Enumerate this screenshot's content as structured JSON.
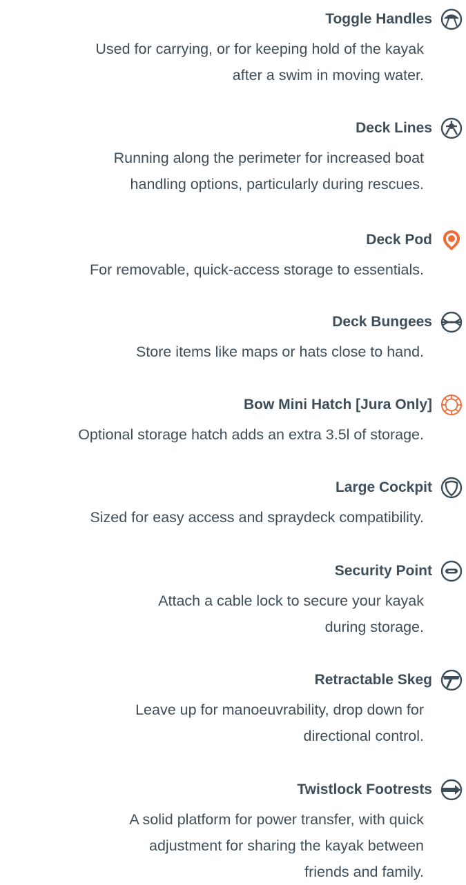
{
  "colors": {
    "text": "#3e4e59",
    "accent": "#ee6c3a"
  },
  "features": [
    {
      "title": "Toggle Handles",
      "icon": "toggle-handle-icon",
      "description": [
        "Used for carrying, or for keeping hold of the kayak",
        "after a swim in moving water."
      ]
    },
    {
      "title": "Deck Lines",
      "icon": "deck-lines-icon",
      "description": [
        "Running along the perimeter for increased boat",
        "handling options, particularly during rescues."
      ]
    },
    {
      "title": "Deck Pod",
      "icon": "deck-pod-icon",
      "description": [
        "For removable, quick-access storage to essentials."
      ]
    },
    {
      "title": "Deck Bungees",
      "icon": "deck-bungees-icon",
      "description": [
        "Store items like maps or hats close to hand."
      ]
    },
    {
      "title": "Bow Mini Hatch [Jura Only]",
      "icon": "bow-hatch-icon",
      "description": [
        "Optional storage hatch adds an extra  3.5l of storage."
      ]
    },
    {
      "title": "Large Cockpit",
      "icon": "cockpit-icon",
      "description": [
        "Sized for easy access and spraydeck compatibility."
      ]
    },
    {
      "title": "Security Point",
      "icon": "security-point-icon",
      "description": [
        "Attach a cable lock to secure your kayak",
        "during storage."
      ]
    },
    {
      "title": "Retractable Skeg",
      "icon": "skeg-icon",
      "description": [
        "Leave up for manoeuvrability, drop down for",
        "directional control."
      ]
    },
    {
      "title": "Twistlock Footrests",
      "icon": "footrest-icon",
      "description": [
        "A solid platform for power transfer, with quick",
        "adjustment for sharing the kayak between",
        "friends and family."
      ]
    }
  ]
}
